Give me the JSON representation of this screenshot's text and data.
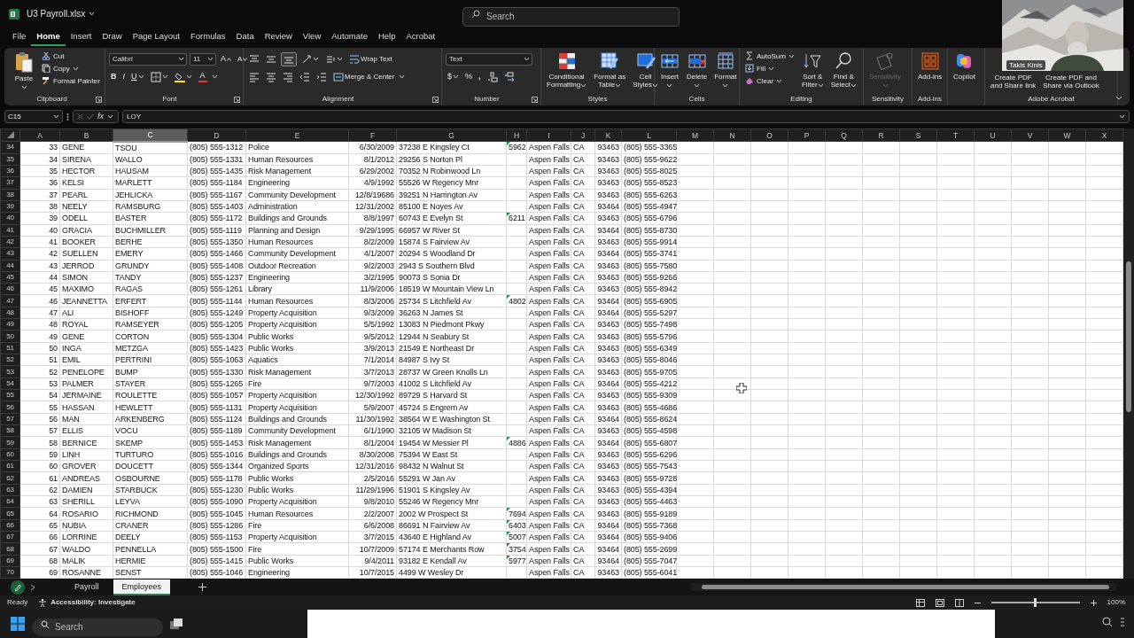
{
  "title_bar": {
    "file_name": "U3 Payroll.xlsx",
    "search": {
      "placeholder": "Search"
    }
  },
  "video_overlay": {
    "kind": "picture",
    "name_label": "Takis Kinis"
  },
  "menu_tabs": [
    {
      "label": "File",
      "selected": false
    },
    {
      "label": "Home",
      "selected": true
    },
    {
      "label": "Insert",
      "selected": false
    },
    {
      "label": "Draw",
      "selected": false
    },
    {
      "label": "Page Layout",
      "selected": false
    },
    {
      "label": "Formulas",
      "selected": false
    },
    {
      "label": "Data",
      "selected": false
    },
    {
      "label": "Review",
      "selected": false
    },
    {
      "label": "View",
      "selected": false
    },
    {
      "label": "Automate",
      "selected": false
    },
    {
      "label": "Help",
      "selected": false
    },
    {
      "label": "Acrobat",
      "selected": false
    }
  ],
  "ribbon": [
    {
      "kind": "generic",
      "label": "Clipboard",
      "launcher": true,
      "buttons": [
        {
          "kind": "paste",
          "lines": [
            "Paste"
          ],
          "dropdown": true,
          "disabled": false
        }
      ],
      "small": [
        {
          "kind": "cut",
          "label": "Cut",
          "dropdown": false
        },
        {
          "kind": "copy",
          "label": "Copy",
          "dropdown": true
        },
        {
          "kind": "painter",
          "label": "Format Painter",
          "dropdown": false
        }
      ]
    },
    {
      "kind": "font",
      "label": "Font",
      "launcher": true,
      "font_name": "Calibri",
      "font_size": "11",
      "grow": "A",
      "shrink": "A",
      "bold": "B",
      "italic": "I",
      "underline": "U",
      "font_color": "A"
    },
    {
      "kind": "alignment",
      "label": "Alignment",
      "launcher": true,
      "vertical_align": [
        {
          "selected": false
        },
        {
          "selected": false
        },
        {
          "selected": true
        }
      ],
      "wrap_text": "Wrap Text",
      "merge_center": "Merge & Center"
    },
    {
      "kind": "number",
      "label": "Number",
      "launcher": true,
      "format": "Text",
      "currency": "$",
      "percent": "%",
      "comma": ","
    },
    {
      "kind": "generic",
      "label": "Styles",
      "buttons": [
        {
          "kind": "conditional",
          "lines": [
            "Conditional",
            "Formatting"
          ],
          "dropdown": true,
          "disabled": false
        },
        {
          "kind": "table",
          "lines": [
            "Format as",
            "Table"
          ],
          "dropdown": true,
          "disabled": false
        },
        {
          "kind": "cellstyles",
          "lines": [
            "Cell",
            "Styles"
          ],
          "dropdown": true,
          "disabled": false
        }
      ]
    },
    {
      "kind": "generic",
      "label": "Cells",
      "buttons": [
        {
          "kind": "insert",
          "lines": [
            "Insert"
          ],
          "dropdown": true,
          "disabled": false
        },
        {
          "kind": "delete",
          "lines": [
            "Delete"
          ],
          "dropdown": true,
          "disabled": false
        },
        {
          "kind": "format",
          "lines": [
            "Format"
          ],
          "dropdown": true,
          "disabled": false
        }
      ]
    },
    {
      "kind": "generic",
      "label": "Editing",
      "small": [
        {
          "kind": "autosum",
          "label": "AutoSum",
          "dropdown": true
        },
        {
          "kind": "fill",
          "label": "Fill",
          "dropdown": true
        },
        {
          "kind": "clear",
          "label": "Clear",
          "dropdown": true
        }
      ],
      "buttons": [
        {
          "kind": "sort",
          "lines": [
            "Sort &",
            "Filter"
          ],
          "dropdown": true,
          "disabled": false
        },
        {
          "kind": "find",
          "lines": [
            "Find &",
            "Select"
          ],
          "dropdown": true,
          "disabled": false
        }
      ]
    },
    {
      "kind": "generic",
      "label": "Sensitivity",
      "buttons": [
        {
          "kind": "sensitivity",
          "lines": [
            "Sensitivity"
          ],
          "dropdown": true,
          "disabled": true
        }
      ]
    },
    {
      "kind": "generic",
      "label": "Add-ins",
      "buttons": [
        {
          "kind": "addins",
          "lines": [
            "Add-ins"
          ],
          "dropdown": false,
          "disabled": false
        }
      ]
    },
    {
      "kind": "generic",
      "buttons": [
        {
          "kind": "copilot",
          "lines": [
            "Copilot"
          ],
          "dropdown": false,
          "disabled": false
        }
      ]
    },
    {
      "kind": "generic",
      "label": "Adobe Acrobat",
      "buttons": [
        {
          "kind": "pdf",
          "lines": [
            "Create PDF",
            "and Share link"
          ],
          "dropdown": false,
          "disabled": false
        },
        {
          "kind": "pdf",
          "lines": [
            "Create PDF and",
            "Share via Outlook"
          ],
          "dropdown": false,
          "disabled": false
        }
      ]
    }
  ],
  "formula_bar": {
    "name_box": "C15",
    "fx": "fx",
    "value": "LOY"
  },
  "sheet": {
    "columns": [
      {
        "label": "A",
        "selected": false
      },
      {
        "label": "B",
        "selected": false
      },
      {
        "label": "C",
        "selected": true
      },
      {
        "label": "D",
        "selected": false
      },
      {
        "label": "E",
        "selected": false
      },
      {
        "label": "F",
        "selected": false
      },
      {
        "label": "G",
        "selected": false
      },
      {
        "label": "H",
        "selected": false
      },
      {
        "label": "I",
        "selected": false
      },
      {
        "label": "J",
        "selected": false
      },
      {
        "label": "K",
        "selected": false
      },
      {
        "label": "L",
        "selected": false
      },
      {
        "label": "M",
        "selected": false
      },
      {
        "label": "N",
        "selected": false
      },
      {
        "label": "O",
        "selected": false
      },
      {
        "label": "P",
        "selected": false
      },
      {
        "label": "Q",
        "selected": false
      },
      {
        "label": "R",
        "selected": false
      },
      {
        "label": "S",
        "selected": false
      },
      {
        "label": "T",
        "selected": false
      },
      {
        "label": "U",
        "selected": false
      },
      {
        "label": "V",
        "selected": false
      },
      {
        "label": "W",
        "selected": false
      },
      {
        "label": "X",
        "selected": false
      }
    ],
    "rows": [
      {
        "number": "34",
        "flagged": true,
        "cells": [
          "33",
          "GENE",
          "TSOU",
          "(805) 555-1312",
          "Police",
          "6/30/2009",
          "37238 E Kingsley Ct",
          "5962",
          "Aspen Falls",
          "CA",
          "93463",
          "(805) 555-3365"
        ]
      },
      {
        "number": "35",
        "flagged": false,
        "cells": [
          "34",
          "SIRENA",
          "WALLO",
          "(805) 555-1331",
          "Human Resources",
          "8/1/2012",
          "29256 S Norton Pl",
          null,
          "Aspen Falls",
          "CA",
          "93463",
          "(805) 555-9622"
        ]
      },
      {
        "number": "36",
        "flagged": false,
        "cells": [
          "35",
          "HECTOR",
          "HAUSAM",
          "(805) 555-1435",
          "Risk Management",
          "6/29/2002",
          "70352 N Robinwood Ln",
          null,
          "Aspen Falls",
          "CA",
          "93463",
          "(805) 555-8025"
        ]
      },
      {
        "number": "37",
        "flagged": false,
        "cells": [
          "36",
          "KELSI",
          "MARLETT",
          "(805) 555-1184",
          "Engineering",
          "4/9/1992",
          "55526 W Regency Mnr",
          null,
          "Aspen Falls",
          "CA",
          "93463",
          "(805) 555-8523"
        ]
      },
      {
        "number": "38",
        "flagged": false,
        "cells": [
          "37",
          "PEARL",
          "JEHLICKA",
          "(805) 555-1167",
          "Community Development",
          "12/8/19686",
          "39251 N Harrington Av",
          null,
          "Aspen Falls",
          "CA",
          "93463",
          "(805) 555-6263"
        ]
      },
      {
        "number": "39",
        "flagged": false,
        "cells": [
          "38",
          "NEELY",
          "RAMSBURG",
          "(805) 555-1403",
          "Administration",
          "12/31/2002",
          "85100 E Noyes Av",
          null,
          "Aspen Falls",
          "CA",
          "93464",
          "(805) 555-4947"
        ]
      },
      {
        "number": "40",
        "flagged": true,
        "cells": [
          "39",
          "ODELL",
          "BASTER",
          "(805) 555-1172",
          "Buildings and Grounds",
          "8/8/1997",
          "60743 E Evelyn St",
          "6211",
          "Aspen Falls",
          "CA",
          "93463",
          "(805) 555-6796"
        ]
      },
      {
        "number": "41",
        "flagged": false,
        "cells": [
          "40",
          "GRACIA",
          "BUCHMILLER",
          "(805) 555-1119",
          "Planning and Design",
          "9/29/1995",
          "66957 W River St",
          null,
          "Aspen Falls",
          "CA",
          "93464",
          "(805) 555-8730"
        ]
      },
      {
        "number": "42",
        "flagged": false,
        "cells": [
          "41",
          "BOOKER",
          "BERHE",
          "(805) 555-1350",
          "Human Resources",
          "8/2/2009",
          "15874 S Fairview Av",
          null,
          "Aspen Falls",
          "CA",
          "93463",
          "(805) 555-9914"
        ]
      },
      {
        "number": "43",
        "flagged": false,
        "cells": [
          "42",
          "SUELLEN",
          "EMERY",
          "(805) 555-1466",
          "Community Development",
          "4/1/2007",
          "20294 S Woodland Dr",
          null,
          "Aspen Falls",
          "CA",
          "93464",
          "(805) 555-3741"
        ]
      },
      {
        "number": "44",
        "flagged": false,
        "cells": [
          "43",
          "JERROD",
          "GRUNDY",
          "(805) 555-1408",
          "Outdoor Recreation",
          "9/2/2003",
          "2943 S Southern Blvd",
          null,
          "Aspen Falls",
          "CA",
          "93463",
          "(805) 555-7580"
        ]
      },
      {
        "number": "45",
        "flagged": false,
        "cells": [
          "44",
          "SIMON",
          "TANDY",
          "(805) 555-1237",
          "Engineering",
          "3/2/1995",
          "90073 S Sonia Dr",
          null,
          "Aspen Falls",
          "CA",
          "93463",
          "(805) 555-9266"
        ]
      },
      {
        "number": "46",
        "flagged": false,
        "cells": [
          "45",
          "MAXIMO",
          "RAGAS",
          "(805) 555-1261",
          "Library",
          "11/9/2006",
          "18519 W Mountain View Ln",
          null,
          "Aspen Falls",
          "CA",
          "93463",
          "(805) 555-8942"
        ]
      },
      {
        "number": "47",
        "flagged": true,
        "cells": [
          "46",
          "JEANNETTA",
          "ERFERT",
          "(805) 555-1144",
          "Human Resources",
          "8/3/2006",
          "25734 S Litchfield Av",
          "4802",
          "Aspen Falls",
          "CA",
          "93464",
          "(805) 555-6905"
        ]
      },
      {
        "number": "48",
        "flagged": false,
        "cells": [
          "47",
          "ALI",
          "BISHOFF",
          "(805) 555-1249",
          "Property Acquisition",
          "9/3/2009",
          "36263 N James St",
          null,
          "Aspen Falls",
          "CA",
          "93464",
          "(805) 555-5297"
        ]
      },
      {
        "number": "49",
        "flagged": false,
        "cells": [
          "48",
          "ROYAL",
          "RAMSEYER",
          "(805) 555-1205",
          "Property Acquisition",
          "5/5/1992",
          "13083 N Piedmont Pkwy",
          null,
          "Aspen Falls",
          "CA",
          "93463",
          "(805) 555-7498"
        ]
      },
      {
        "number": "50",
        "flagged": false,
        "cells": [
          "49",
          "GENE",
          "CORTON",
          "(805) 555-1304",
          "Public Works",
          "9/5/2012",
          "12944 N Seabury St",
          null,
          "Aspen Falls",
          "CA",
          "93463",
          "(805) 555-5796"
        ]
      },
      {
        "number": "51",
        "flagged": false,
        "cells": [
          "50",
          "INGA",
          "METZGA",
          "(805) 555-1423",
          "Public Works",
          "3/9/2013",
          "21549 E Northeast Dr",
          null,
          "Aspen Falls",
          "CA",
          "93463",
          "(805) 555-6349"
        ]
      },
      {
        "number": "52",
        "flagged": false,
        "cells": [
          "51",
          "EMIL",
          "PERTRINI",
          "(805) 555-1063",
          "Aquatics",
          "7/1/2014",
          "84987 S Ivy St",
          null,
          "Aspen Falls",
          "CA",
          "93463",
          "(805) 555-8046"
        ]
      },
      {
        "number": "53",
        "flagged": false,
        "cells": [
          "52",
          "PENELOPE",
          "BUMP",
          "(805) 555-1330",
          "Risk Management",
          "3/7/2013",
          "28737 W Green Knolls Ln",
          null,
          "Aspen Falls",
          "CA",
          "93463",
          "(805) 555-9705"
        ]
      },
      {
        "number": "54",
        "flagged": false,
        "cells": [
          "53",
          "PALMER",
          "STAYER",
          "(805) 555-1265",
          "Fire",
          "9/7/2003",
          "41002 S Litchfield Av",
          null,
          "Aspen Falls",
          "CA",
          "93464",
          "(805) 555-4212"
        ]
      },
      {
        "number": "55",
        "flagged": false,
        "cells": [
          "54",
          "JERMAINE",
          "ROULETTE",
          "(805) 555-1057",
          "Property Acquisition",
          "12/30/1992",
          "89729 S Harvard St",
          null,
          "Aspen Falls",
          "CA",
          "93463",
          "(805) 555-9309"
        ]
      },
      {
        "number": "56",
        "flagged": false,
        "cells": [
          "55",
          "HASSAN",
          "HEWLETT",
          "(805) 555-1131",
          "Property Acquisition",
          "5/9/2007",
          "45724 S Engrem Av",
          null,
          "Aspen Falls",
          "CA",
          "93463",
          "(805) 555-4686"
        ]
      },
      {
        "number": "57",
        "flagged": false,
        "cells": [
          "56",
          "MAN",
          "ARKENBERG",
          "(805) 555-1124",
          "Buildings and Grounds",
          "11/30/1992",
          "38564 W E Washington St",
          null,
          "Aspen Falls",
          "CA",
          "93464",
          "(805) 555-8624"
        ]
      },
      {
        "number": "58",
        "flagged": false,
        "cells": [
          "57",
          "ELLIS",
          "VOCU",
          "(805) 555-1189",
          "Community Development",
          "6/1/1990",
          "32105 W Madison St",
          null,
          "Aspen Falls",
          "CA",
          "93463",
          "(805) 555-4598"
        ]
      },
      {
        "number": "59",
        "flagged": true,
        "cells": [
          "58",
          "BERNICE",
          "SKEMP",
          "(805) 555-1453",
          "Risk Management",
          "8/1/2004",
          "19454 W Messier Pl",
          "4886",
          "Aspen Falls",
          "CA",
          "93464",
          "(805) 555-6807"
        ]
      },
      {
        "number": "60",
        "flagged": false,
        "cells": [
          "59",
          "LINH",
          "TURTURO",
          "(805) 555-1016",
          "Buildings and Grounds",
          "8/30/2008",
          "75394 W East St",
          null,
          "Aspen Falls",
          "CA",
          "93463",
          "(805) 555-6296"
        ]
      },
      {
        "number": "61",
        "flagged": false,
        "cells": [
          "60",
          "GROVER",
          "DOUCETT",
          "(805) 555-1344",
          "Organized Sports",
          "12/31/2016",
          "98432 N Walnut St",
          null,
          "Aspen Falls",
          "CA",
          "93463",
          "(805) 555-7543"
        ]
      },
      {
        "number": "62",
        "flagged": false,
        "cells": [
          "61",
          "ANDREAS",
          "OSBOURNE",
          "(805) 555-1178",
          "Public Works",
          "2/5/2016",
          "55291 W Jan Av",
          null,
          "Aspen Falls",
          "CA",
          "93463",
          "(805) 555-9728"
        ]
      },
      {
        "number": "63",
        "flagged": false,
        "cells": [
          "62",
          "DAMIEN",
          "STARBUCK",
          "(805) 555-1230",
          "Public Works",
          "11/29/1996",
          "51901 S Kingsley Av",
          null,
          "Aspen Falls",
          "CA",
          "93463",
          "(805) 555-4394"
        ]
      },
      {
        "number": "64",
        "flagged": false,
        "cells": [
          "63",
          "SHERILL",
          "LEYVA",
          "(805) 555-1090",
          "Property Acquisition",
          "9/8/2010",
          "55246 W Regency Mnr",
          null,
          "Aspen Falls",
          "CA",
          "93463",
          "(805) 555-4463"
        ]
      },
      {
        "number": "65",
        "flagged": true,
        "cells": [
          "64",
          "ROSARIO",
          "RICHMOND",
          "(805) 555-1045",
          "Human Resources",
          "2/2/2007",
          "2002 W Prospect St",
          "7694",
          "Aspen Falls",
          "CA",
          "93463",
          "(805) 555-9189"
        ]
      },
      {
        "number": "66",
        "flagged": true,
        "cells": [
          "65",
          "NUBIA",
          "CRANER",
          "(805) 555-1286",
          "Fire",
          "6/6/2008",
          "86691 N Fairview Av",
          "6403",
          "Aspen Falls",
          "CA",
          "93464",
          "(805) 555-7368"
        ]
      },
      {
        "number": "67",
        "flagged": true,
        "cells": [
          "66",
          "LORRINE",
          "DEELY",
          "(805) 555-1153",
          "Property Acquisition",
          "3/7/2015",
          "43640 E Highland Av",
          "5007",
          "Aspen Falls",
          "CA",
          "93464",
          "(805) 555-9406"
        ]
      },
      {
        "number": "68",
        "flagged": true,
        "cells": [
          "67",
          "WALDO",
          "PENNELLA",
          "(805) 555-1500",
          "Fire",
          "10/7/2009",
          "57174 E Merchants Row",
          "3754",
          "Aspen Falls",
          "CA",
          "93464",
          "(805) 555-2699"
        ]
      },
      {
        "number": "69",
        "flagged": true,
        "cells": [
          "68",
          "MALIK",
          "HERMIE",
          "(805) 555-1415",
          "Public Works",
          "9/4/2011",
          "93182 E Kendall Av",
          "5977",
          "Aspen Falls",
          "CA",
          "93464",
          "(805) 555-7047"
        ]
      },
      {
        "number": "70",
        "flagged": false,
        "cells": [
          "69",
          "ROSANNE",
          "SENST",
          "(805) 555-1046",
          "Engineering",
          "10/7/2015",
          "4499 W Wesley Dr",
          null,
          "Aspen Falls",
          "CA",
          "93463",
          "(805) 555-6041"
        ]
      }
    ]
  },
  "sheet_tabs": [
    {
      "label": "Payroll",
      "selected": false
    },
    {
      "label": "Employees",
      "selected": true
    }
  ],
  "status_bar": {
    "ready": "Ready",
    "accessibility": "Accessibility: Investigate",
    "zoom_slider": {
      "level": 0.5
    },
    "zoom": "100%"
  },
  "taskbar": {
    "search": {
      "placeholder": "Search"
    }
  }
}
